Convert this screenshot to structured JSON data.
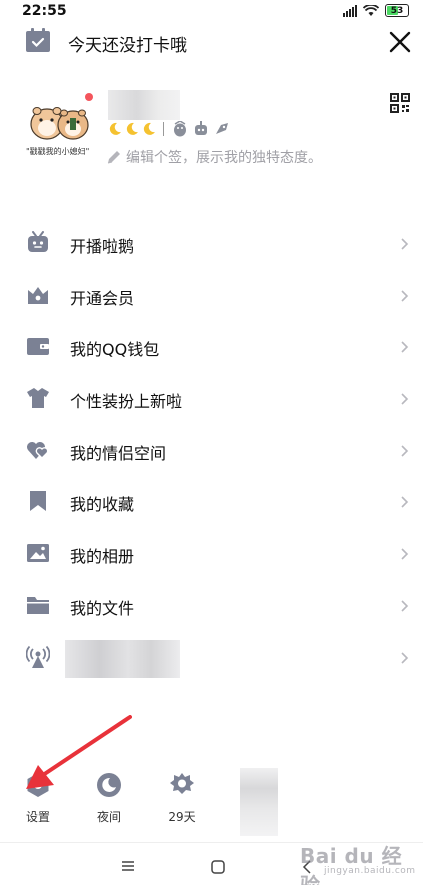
{
  "status_bar": {
    "time": "22:55",
    "battery": "53"
  },
  "header": {
    "checkin_text": "今天还没打卡哦"
  },
  "profile": {
    "avatar_caption": "\"戳戳我的小媳妇\"",
    "signature": "编辑个签，展示我的独特态度。"
  },
  "menu": {
    "items": [
      {
        "label": "开播啦鹅",
        "icon": "tv-icon"
      },
      {
        "label": "开通会员",
        "icon": "crown-icon"
      },
      {
        "label": "我的QQ钱包",
        "icon": "wallet-icon"
      },
      {
        "label": "个性装扮上新啦",
        "icon": "shirt-icon"
      },
      {
        "label": "我的情侣空间",
        "icon": "hearts-icon"
      },
      {
        "label": "我的收藏",
        "icon": "bookmark-icon"
      },
      {
        "label": "我的相册",
        "icon": "photo-icon"
      },
      {
        "label": "我的文件",
        "icon": "folder-icon"
      },
      {
        "label": "",
        "icon": "antenna-icon"
      }
    ]
  },
  "bottom_tools": {
    "settings": "设置",
    "night": "夜间",
    "days": "29天"
  },
  "watermark": {
    "brand": "Bai du 经验",
    "sub": "jingyan.baidu.com"
  },
  "colors": {
    "icon": "#7b8194",
    "chevron": "#b8b8be",
    "accent_red": "#e8323a"
  }
}
